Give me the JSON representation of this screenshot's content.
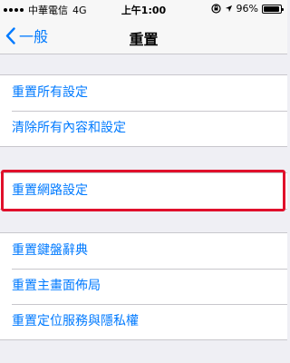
{
  "status_bar": {
    "carrier": "中華電信",
    "network": "4G",
    "time": "上午1:00",
    "battery": "96%",
    "battery_level": 0.96
  },
  "nav": {
    "back_label": "一般",
    "title": "重置"
  },
  "groups": [
    {
      "items": [
        "重置所有設定",
        "清除所有內容和設定"
      ]
    },
    {
      "items": [
        "重置網路設定"
      ]
    },
    {
      "items": [
        "重置鍵盤辭典",
        "重置主畫面佈局",
        "重置定位服務與隱私權"
      ]
    }
  ],
  "colors": {
    "accent": "#007aff",
    "highlight": "#e0102b",
    "background": "#efeff4"
  }
}
